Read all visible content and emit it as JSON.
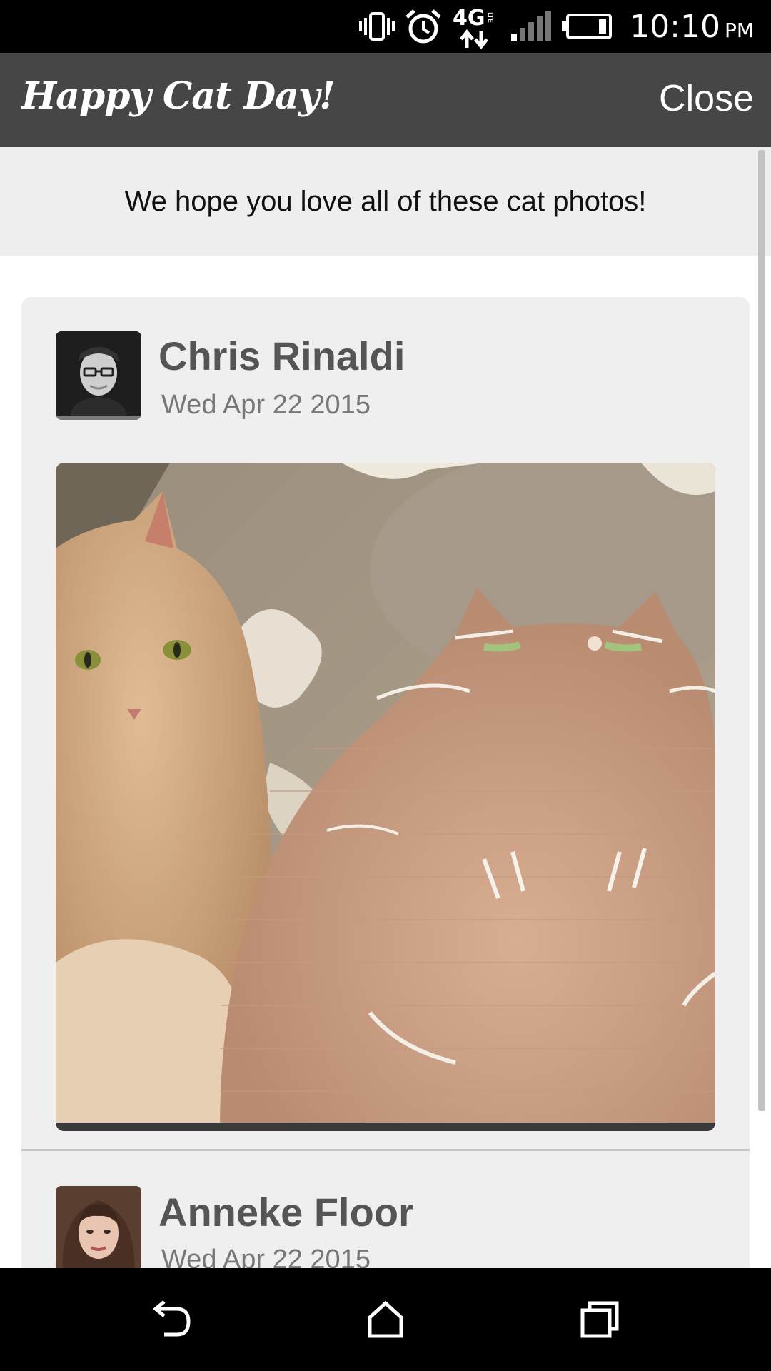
{
  "status_bar": {
    "time": "10:10",
    "ampm": "PM",
    "network": "4G LTE",
    "icons": [
      "vibrate-icon",
      "alarm-icon",
      "network-4g-lte-icon",
      "signal-icon",
      "battery-icon"
    ]
  },
  "app_bar": {
    "title": "Happy Cat Day!",
    "close_label": "Close"
  },
  "banner": {
    "text": "We hope you love all of these cat photos!"
  },
  "posts": [
    {
      "author": "Chris Rinaldi",
      "date": "Wed Apr 22 2015"
    },
    {
      "author": "Anneke Floor",
      "date": "Wed Apr 22 2015"
    }
  ],
  "nav_bar": {
    "icons": [
      "back-icon",
      "home-icon",
      "recent-apps-icon"
    ]
  },
  "colors": {
    "app_bar_bg": "#464646",
    "banner_bg": "#eeeeee",
    "card_bg": "#efefef",
    "author_text": "#555555",
    "date_text": "#777777"
  }
}
